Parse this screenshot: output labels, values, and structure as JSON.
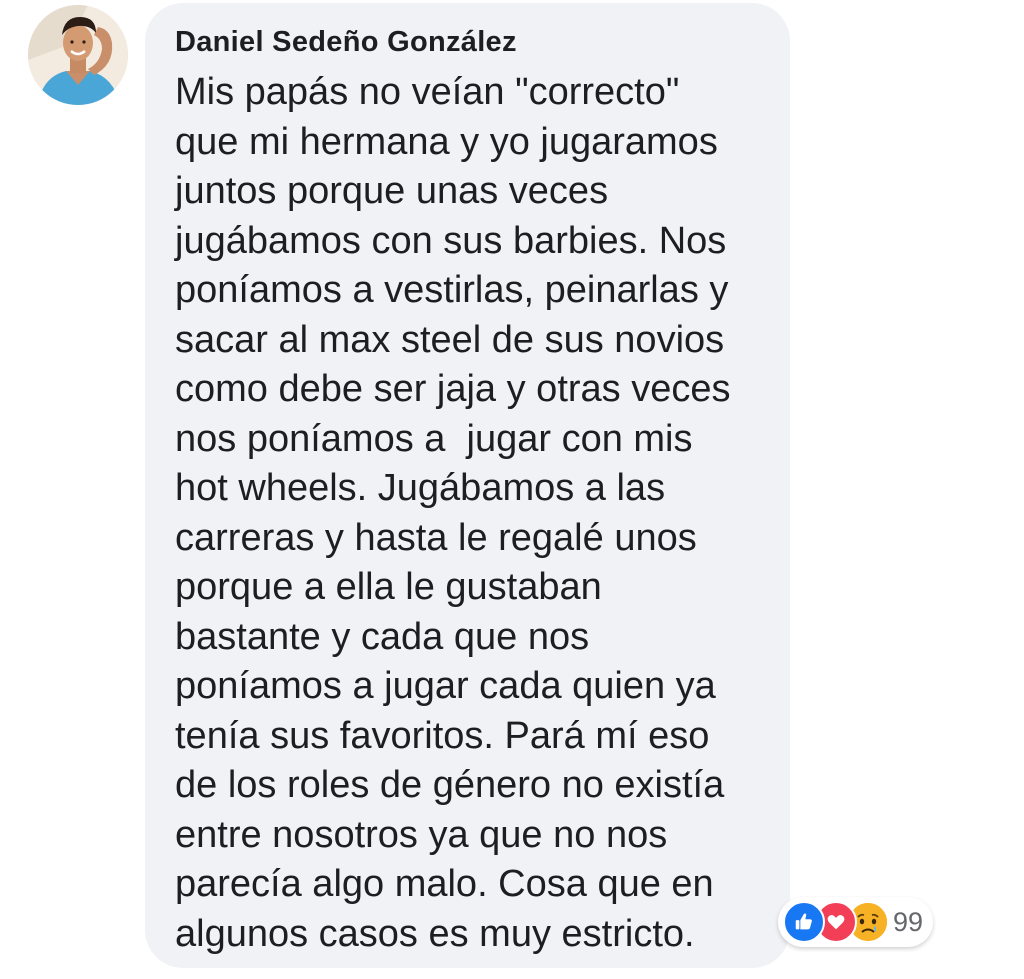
{
  "comment": {
    "author": "Daniel Sedeño González",
    "lines": [
      "Mis papás no veían \"correcto\"",
      "que mi hermana y yo jugaramos",
      "juntos porque unas veces",
      "jugábamos con sus barbies. Nos",
      "poníamos a vestirlas, peinarlas y",
      "sacar al max steel de sus novios",
      "como debe ser jaja y otras veces",
      "nos poníamos a  jugar con mis",
      "hot wheels. Jugábamos a las",
      "carreras y hasta le regalé unos",
      "porque a ella le gustaban",
      "bastante y cada que nos",
      "poníamos a jugar cada quien ya",
      "tenía sus favoritos. Pará mí eso",
      "de los roles de género no existía",
      "entre nosotros ya que no nos",
      "parecía algo malo. Cosa que en",
      "algunos casos es muy estricto."
    ]
  },
  "reactions": {
    "icons": [
      "like-icon",
      "love-icon",
      "sad-icon"
    ],
    "count": "99"
  },
  "colors": {
    "bubble": "#f0f2f5",
    "text": "#1c1e21",
    "like": "#1877f2",
    "love": "#f33e58",
    "sad": "#f7b125",
    "count": "#65676b"
  }
}
